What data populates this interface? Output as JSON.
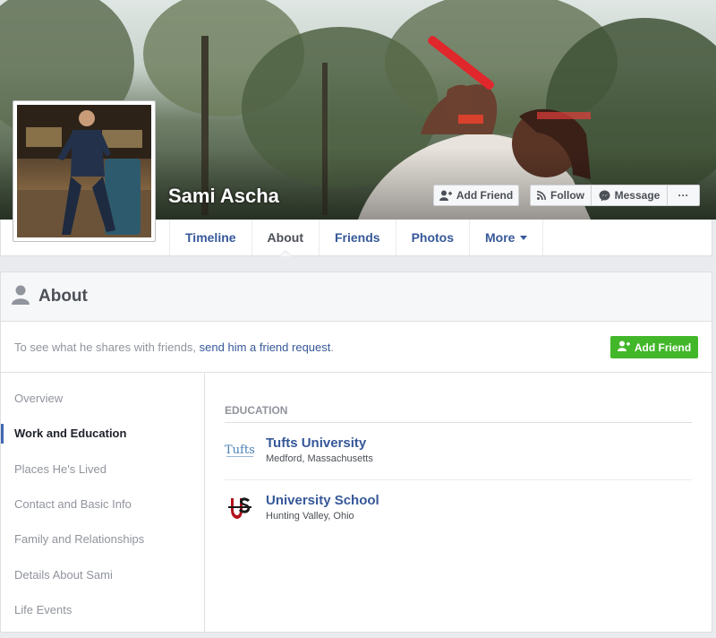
{
  "profile": {
    "name": "Sami Ascha"
  },
  "cover_actions": {
    "add_friend": "Add Friend",
    "follow": "Follow",
    "message": "Message",
    "more": "···"
  },
  "nav": {
    "tabs": [
      {
        "label": "Timeline"
      },
      {
        "label": "About"
      },
      {
        "label": "Friends"
      },
      {
        "label": "Photos"
      },
      {
        "label": "More"
      }
    ]
  },
  "about": {
    "title": "About",
    "friend_request_text": "To see what he shares with friends, ",
    "friend_request_link": "send him a friend request",
    "friend_request_period": ".",
    "add_friend_label": "Add Friend",
    "sidebar": [
      {
        "label": "Overview"
      },
      {
        "label": "Work and Education"
      },
      {
        "label": "Places He's Lived"
      },
      {
        "label": "Contact and Basic Info"
      },
      {
        "label": "Family and Relationships"
      },
      {
        "label": "Details About Sami"
      },
      {
        "label": "Life Events"
      }
    ],
    "section_heading": "EDUCATION",
    "education": [
      {
        "name": "Tufts University",
        "location": "Medford, Massachusetts",
        "logo_text": "Tufts",
        "logo_color": "#4a7db5"
      },
      {
        "name": "University School",
        "location": "Hunting Valley, Ohio",
        "logo_text": "US",
        "logo_color": "#b3121b"
      }
    ]
  },
  "colors": {
    "link_blue": "#365899",
    "active_indicator": "#4267b2",
    "add_friend_green": "#42b72a"
  }
}
